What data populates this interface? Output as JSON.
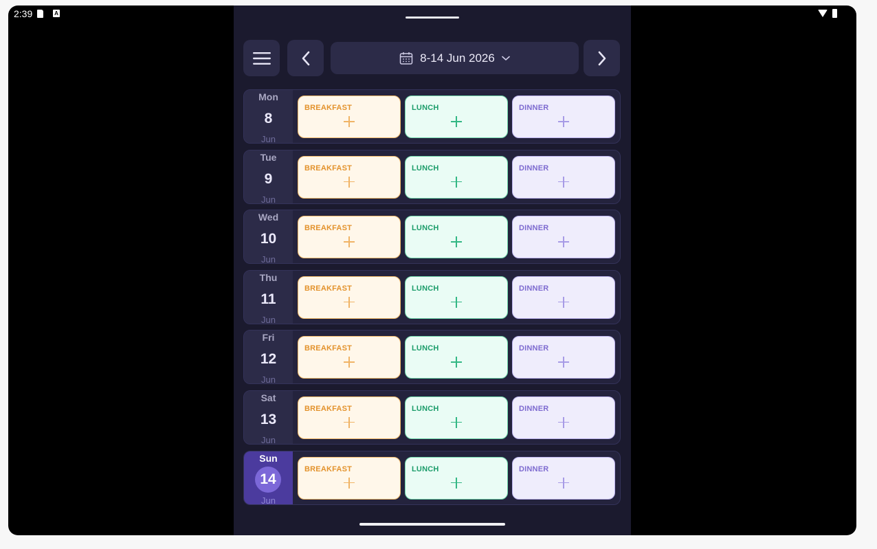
{
  "status_bar": {
    "time": "2:39",
    "icons": [
      "sd-card-icon",
      "a-icon",
      "wifi-icon",
      "battery-icon"
    ]
  },
  "header": {
    "menu_icon": "hamburger-menu-icon",
    "prev_icon": "chevron-left-icon",
    "next_icon": "chevron-right-icon",
    "date_range": "8-14 Jun 2026",
    "calendar_icon": "calendar-icon",
    "dropdown_icon": "chevron-down-icon"
  },
  "meal_labels": {
    "breakfast": "BREAKFAST",
    "lunch": "LUNCH",
    "dinner": "DINNER"
  },
  "days": [
    {
      "name": "Mon",
      "num": "8",
      "month": "Jun",
      "today": false
    },
    {
      "name": "Tue",
      "num": "9",
      "month": "Jun",
      "today": false
    },
    {
      "name": "Wed",
      "num": "10",
      "month": "Jun",
      "today": false
    },
    {
      "name": "Thu",
      "num": "11",
      "month": "Jun",
      "today": false
    },
    {
      "name": "Fri",
      "num": "12",
      "month": "Jun",
      "today": false
    },
    {
      "name": "Sat",
      "num": "13",
      "month": "Jun",
      "today": false
    },
    {
      "name": "Sun",
      "num": "14",
      "month": "Jun",
      "today": true
    }
  ],
  "colors": {
    "background": "#1b1a2e",
    "card": "#24233d",
    "today_accent": "#7c68d8",
    "breakfast": "#e3922c",
    "lunch": "#1b9c6a",
    "dinner": "#7e6bd0"
  }
}
